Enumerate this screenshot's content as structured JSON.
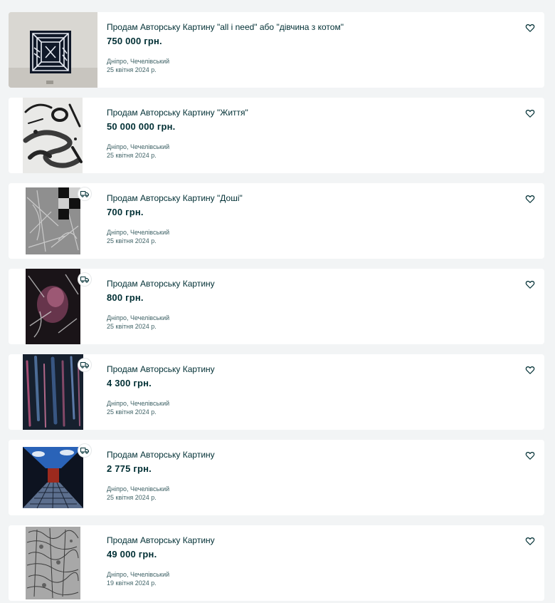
{
  "listings": [
    {
      "title": "Продам Авторську Картину \"all i need\" або \"дівчина з котом\"",
      "price": "750 000 грн.",
      "location": "Дніпро, Чечелівський",
      "date": "25 квітня 2024 р.",
      "delivery": false,
      "thumb_icon": "painting-geometric-bw"
    },
    {
      "title": "Продам Авторську Картину \"Життя\"",
      "price": "50 000 000 грн.",
      "location": "Дніпро, Чечелівський",
      "date": "25 квітня 2024 р.",
      "delivery": false,
      "thumb_icon": "painting-abstract-swirls"
    },
    {
      "title": "Продам Авторську Картину \"Доші\"",
      "price": "700 грн.",
      "location": "Дніпро, Чечелівський",
      "date": "25 квітня 2024 р.",
      "delivery": true,
      "thumb_icon": "painting-grey-checker"
    },
    {
      "title": "Продам Авторську Картину",
      "price": "800 грн.",
      "location": "Дніпро, Чечелівський",
      "date": "25 квітня 2024 р.",
      "delivery": true,
      "thumb_icon": "painting-dark-pink"
    },
    {
      "title": "Продам Авторську Картину",
      "price": "4 300 грн.",
      "location": "Дніпро, Чечелівський",
      "date": "25 квітня 2024 р.",
      "delivery": true,
      "thumb_icon": "painting-blue-streaks"
    },
    {
      "title": "Продам Авторську Картину",
      "price": "2 775 грн.",
      "location": "Дніпро, Чечелівський",
      "date": "25 квітня 2024 р.",
      "delivery": true,
      "thumb_icon": "painting-corridor-clouds"
    },
    {
      "title": "Продам Авторську Картину",
      "price": "49 000 грн.",
      "location": "Дніпро, Чечелівський",
      "date": "19 квітня 2024 р.",
      "delivery": false,
      "thumb_icon": "painting-pattern-doodle"
    }
  ],
  "icons": {
    "favorite": "heart-outline-icon",
    "delivery": "truck-icon"
  },
  "colors": {
    "background": "#f2f4f5",
    "card": "#ffffff",
    "text": "#002f34",
    "muted": "#406367"
  }
}
